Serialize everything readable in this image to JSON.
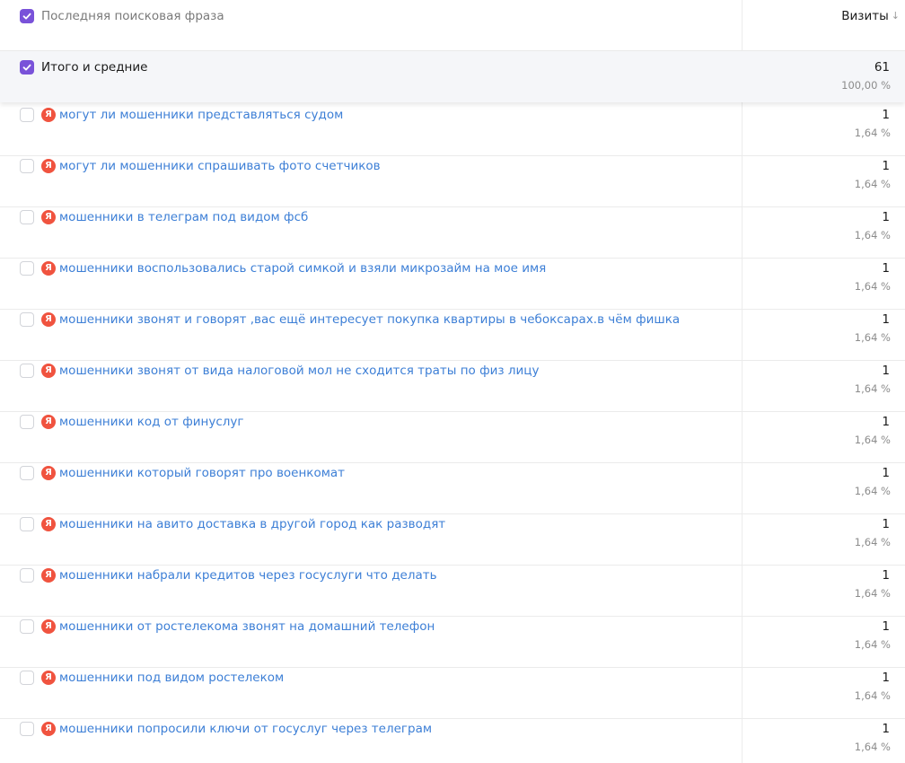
{
  "header": {
    "dimension_label": "Последняя поисковая фраза",
    "metric_label": "Визиты",
    "sort_icon": "↓"
  },
  "total": {
    "label": "Итого и средние",
    "value": "61",
    "percent": "100,00 %"
  },
  "engine_icon": "Я",
  "colors": {
    "accent": "#7952d9",
    "link": "#3d7fd6",
    "yandex": "#f0533f"
  },
  "rows": [
    {
      "phrase": "могут ли мошенники представляться судом",
      "value": "1",
      "percent": "1,64 %"
    },
    {
      "phrase": "могут ли мошенники спрашивать фото счетчиков",
      "value": "1",
      "percent": "1,64 %"
    },
    {
      "phrase": "мошенники в телеграм под видом фсб",
      "value": "1",
      "percent": "1,64 %"
    },
    {
      "phrase": "мошенники воспользовались старой симкой и взяли микрозайм на мое имя",
      "value": "1",
      "percent": "1,64 %"
    },
    {
      "phrase": "мошенники звонят и говорят ,вас ещё интересует покупка квартиры в чебоксарах.в чём фишка",
      "value": "1",
      "percent": "1,64 %"
    },
    {
      "phrase": "мошенники звонят от вида налоговой мол не сходится траты по физ лицу",
      "value": "1",
      "percent": "1,64 %"
    },
    {
      "phrase": "мошенники код от финуслуг",
      "value": "1",
      "percent": "1,64 %"
    },
    {
      "phrase": "мошенники который говорят про военкомат",
      "value": "1",
      "percent": "1,64 %"
    },
    {
      "phrase": "мошенники на авито доставка в другой город как разводят",
      "value": "1",
      "percent": "1,64 %"
    },
    {
      "phrase": "мошенники набрали кредитов через госуслуги что делать",
      "value": "1",
      "percent": "1,64 %"
    },
    {
      "phrase": "мошенники от ростелекома звонят на домашний телефон",
      "value": "1",
      "percent": "1,64 %"
    },
    {
      "phrase": "мошенники под видом ростелеком",
      "value": "1",
      "percent": "1,64 %"
    },
    {
      "phrase": "мошенники попросили ключи от госуслуг через телеграм",
      "value": "1",
      "percent": "1,64 %"
    }
  ]
}
